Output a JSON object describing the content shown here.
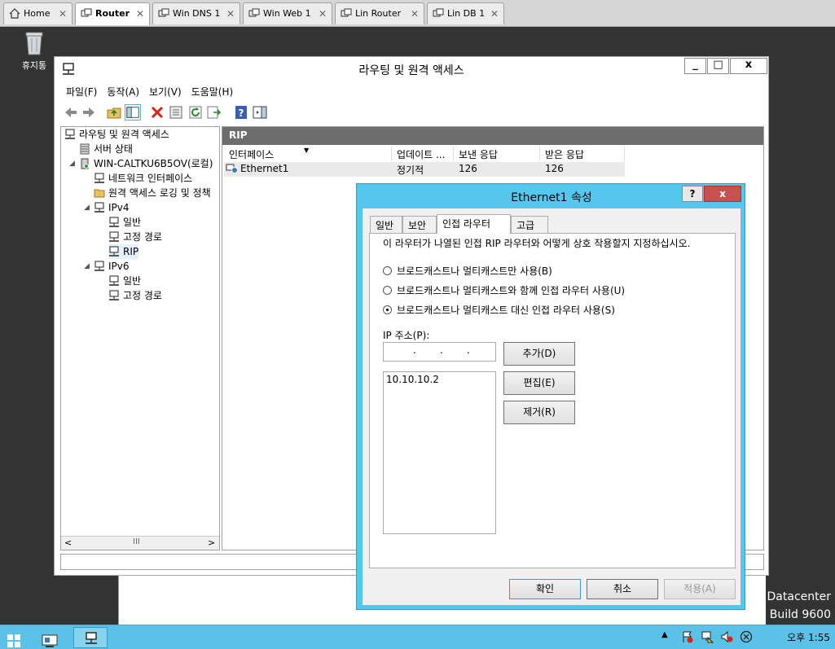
{
  "host_tabs": [
    {
      "label": "Home"
    },
    {
      "label": "Router"
    },
    {
      "label": "Win DNS 1"
    },
    {
      "label": "Win Web 1"
    },
    {
      "label": "Lin Router"
    },
    {
      "label": "Lin DB 1"
    }
  ],
  "desktop": {
    "recycle_bin": "휴지통",
    "watermark_line1": "Datacenter",
    "watermark_line2": "Build 9600"
  },
  "mmc": {
    "title": "라우팅 및 원격 액세스",
    "menu": [
      "파일(F)",
      "동작(A)",
      "보기(V)",
      "도움말(H)"
    ],
    "tree": [
      "라우팅 및 원격 액세스",
      "서버 상태",
      "WIN-CALTKU6B5OV(로컬)",
      "네트워크 인터페이스",
      "원격 액세스 로깅 및 정책",
      "IPv4",
      "일반",
      "고정 경로",
      "RIP",
      "IPv6",
      "일반",
      "고정 경로"
    ],
    "content_header": "RIP",
    "columns": [
      "인터페이스",
      "업데이트 ...",
      "보낸 응답",
      "받은 응답"
    ],
    "rows": [
      [
        "Ethernet1",
        "정기적",
        "126",
        "126"
      ]
    ]
  },
  "dialog": {
    "title": "Ethernet1 속성",
    "help": "?",
    "close": "x",
    "tabs": [
      "일반",
      "보안",
      "인접 라우터",
      "고급"
    ],
    "description": "이 라우터가 나열된 인접 RIP 라우터와 어떻게 상호 작용할지 지정하십시오.",
    "radios": [
      "브로드캐스트나 멀티캐스트만 사용(B)",
      "브로드캐스트나 멀티캐스트와 함께 인접 라우터 사용(U)",
      "브로드캐스트나 멀티캐스트 대신 인접 라우터 사용(S)"
    ],
    "selected_radio": 2,
    "ip_label": "IP 주소(P):",
    "ip_list": [
      "10.10.10.2"
    ],
    "add": "추가(D)",
    "edit": "편집(E)",
    "remove": "제거(R)",
    "ok": "확인",
    "cancel": "취소",
    "apply": "적용(A)"
  },
  "taskbar": {
    "clock": "오후 1:55"
  }
}
